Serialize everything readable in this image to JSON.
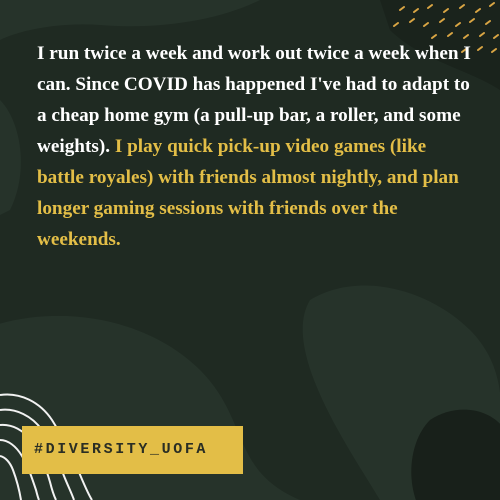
{
  "quote": {
    "text_plain": "I run twice a week and work out twice a week when I can. Since COVID has happened I've had to adapt to a cheap home gym (a pull-up bar, a roller, and some weights). ",
    "text_highlight": "I play quick pick-up video games (like battle royales) with friends almost nightly, and plan longer gaming sessions with friends over the weekends."
  },
  "hashtag": {
    "label": "#DIVERSITY_UOFA"
  },
  "colors": {
    "background": "#1f2a22",
    "blob": "#27352a",
    "accent": "#e3be47",
    "text": "#ffffff"
  }
}
